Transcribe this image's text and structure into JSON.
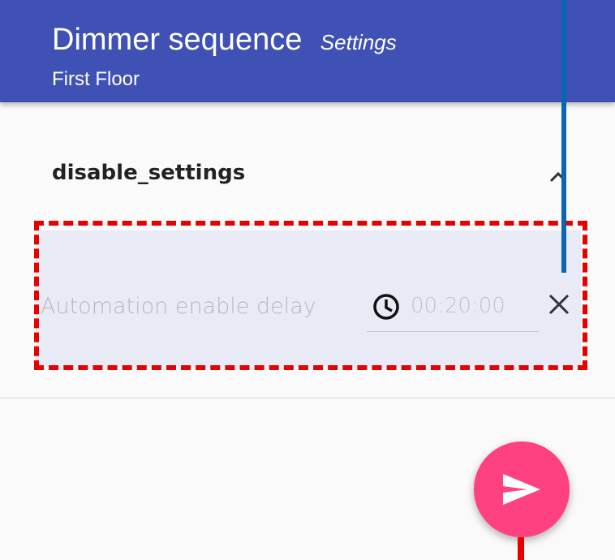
{
  "header": {
    "title": "Dimmer sequence",
    "section_tag": "Settings",
    "subtitle": "First Floor"
  },
  "section": {
    "title": "disable_settings",
    "expanded": true,
    "icon": "chevron-up-icon"
  },
  "setting": {
    "label": "Automation enable delay",
    "value": "00:20:00",
    "value_icon": "clock-icon",
    "clear_icon": "close-icon"
  },
  "fab": {
    "icon": "send-icon",
    "color": "#ff4081"
  },
  "colors": {
    "appbar": "#3f51b5",
    "row_highlight": "#e8eaf6",
    "annotation_red": "#e60000",
    "annotation_blue": "#0a66b0"
  }
}
